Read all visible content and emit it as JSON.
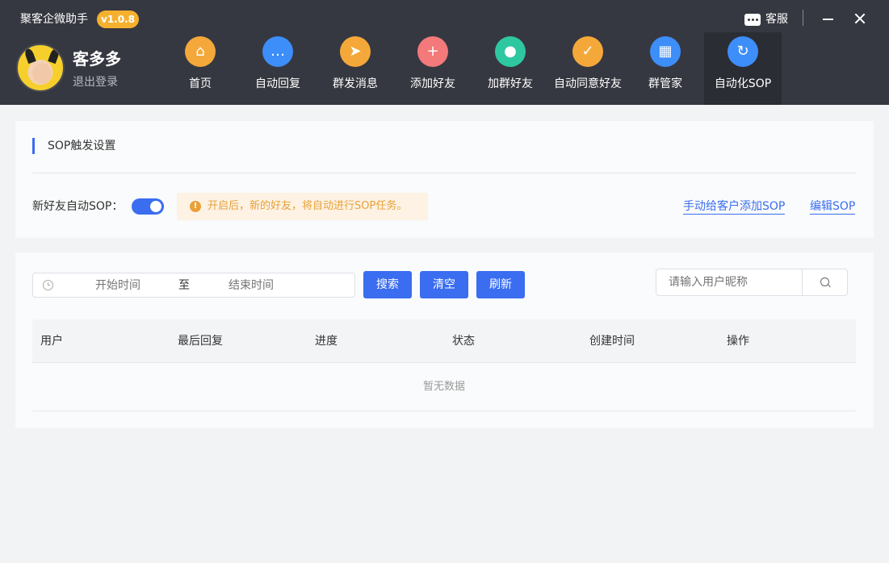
{
  "app": {
    "title": "聚客企微助手",
    "version": "v1.0.8",
    "customer_service": "客服"
  },
  "user": {
    "name": "客多多",
    "logout": "退出登录"
  },
  "nav": {
    "items": [
      {
        "label": "首页",
        "icon": "home-icon",
        "color": "#f5a83a",
        "glyph": "⌂"
      },
      {
        "label": "自动回复",
        "icon": "chat-icon",
        "color": "#3d8ef8",
        "glyph": "…"
      },
      {
        "label": "群发消息",
        "icon": "send-icon",
        "color": "#f5a83a",
        "glyph": "➤"
      },
      {
        "label": "添加好友",
        "icon": "add-user-icon",
        "color": "#f3797a",
        "glyph": "+"
      },
      {
        "label": "加群好友",
        "icon": "group-icon",
        "color": "#2ec7a0",
        "glyph": "●"
      },
      {
        "label": "自动同意好友",
        "icon": "user-check-icon",
        "color": "#f5a83a",
        "glyph": "✓"
      },
      {
        "label": "群管家",
        "icon": "apps-icon",
        "color": "#3d8ef8",
        "glyph": "▦"
      },
      {
        "label": "自动化SOP",
        "icon": "sop-icon",
        "color": "#3d8ef8",
        "glyph": "↻"
      }
    ],
    "active_index": 7
  },
  "sop_settings": {
    "title": "SOP触发设置",
    "toggle_label": "新好友自动SOP：",
    "toggle_on": true,
    "tip": "开启后，新的好友，将自动进行SOP任务。",
    "link_manual": "手动给客户添加SOP",
    "link_edit": "编辑SOP"
  },
  "filters": {
    "start_placeholder": "开始时间",
    "separator": "至",
    "end_placeholder": "结束时间",
    "search_label": "搜索",
    "clear_label": "清空",
    "refresh_label": "刷新",
    "nickname_placeholder": "请输入用户昵称"
  },
  "table": {
    "columns": [
      "用户",
      "最后回复",
      "进度",
      "状态",
      "创建时间",
      "操作"
    ],
    "empty_text": "暂无数据"
  },
  "colors": {
    "accent": "#3a6df0",
    "header_bg": "#363841",
    "badge": "#f5b12e",
    "warning": "#e8a139"
  }
}
